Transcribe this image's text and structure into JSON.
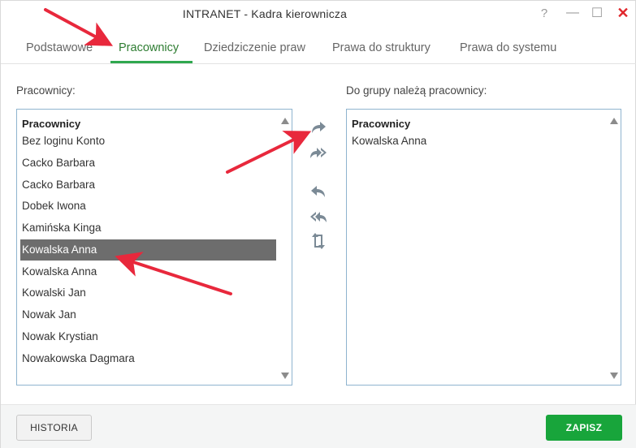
{
  "window": {
    "title": "INTRANET - Kadra kierownicza",
    "help_glyph": "?",
    "min_glyph": "—",
    "max_glyph": "☐",
    "close_glyph": "✕"
  },
  "tabs": [
    {
      "label": "Podstawowe"
    },
    {
      "label": "Pracownicy"
    },
    {
      "label": "Dziedziczenie praw"
    },
    {
      "label": "Prawa do struktury"
    },
    {
      "label": "Prawa do systemu"
    }
  ],
  "left_panel": {
    "label": "Pracownicy:",
    "header": "Pracownicy",
    "items": [
      "Bez loginu Konto",
      "Cacko Barbara",
      "Cacko Barbara",
      "Dobek Iwona",
      "Kamińska Kinga",
      "Kowalska Anna",
      "Kowalska Anna",
      "Kowalski Jan",
      "Nowak Jan",
      "Nowak Krystian",
      "Nowakowska Dagmara"
    ],
    "selected_index": 5
  },
  "right_panel": {
    "label": "Do grupy należą pracownicy:",
    "header": "Pracownicy",
    "items": [
      "Kowalska Anna"
    ]
  },
  "tools": {
    "add_one": "redo-arrow-icon",
    "add_all": "double-redo-arrow-icon",
    "remove_one": "undo-arrow-icon",
    "remove_all": "double-undo-arrow-icon",
    "swap": "swap-icon"
  },
  "footer": {
    "history_label": "HISTORIA",
    "save_label": "ZAPISZ"
  },
  "colors": {
    "accent": "#2fa84f",
    "save": "#18a53b",
    "selected_row": "#6d6d6d",
    "annotation_arrow": "#e8283c",
    "close": "#e0262b"
  }
}
